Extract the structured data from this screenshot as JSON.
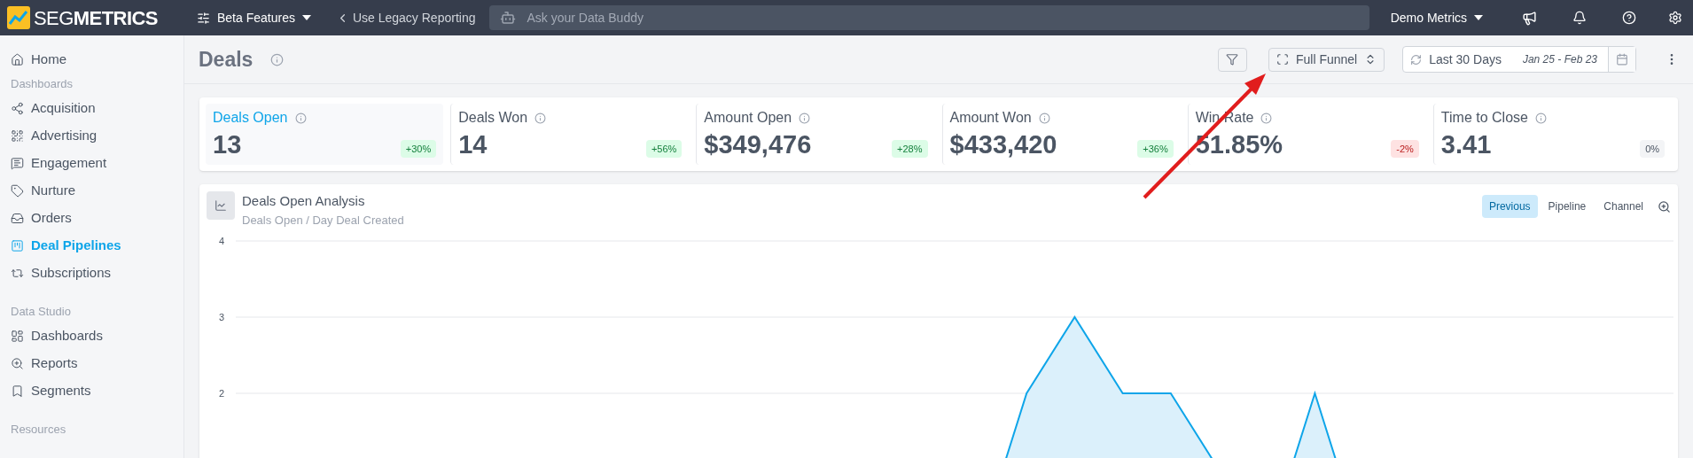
{
  "topbar": {
    "logo": "SEG**METRICS**",
    "beta_menu": "Beta Features",
    "legacy_link": "Use Legacy Reporting",
    "search": {
      "placeholder": "Ask your Data Buddy"
    },
    "account_menu": "Demo Metrics"
  },
  "sidebar": {
    "home": {
      "label": "Home",
      "selected": false
    },
    "sections": [
      {
        "heading": "Dashboards",
        "items": [
          {
            "label": "Acquisition",
            "selected": false
          },
          {
            "label": "Advertising",
            "selected": false
          },
          {
            "label": "Engagement",
            "selected": false
          },
          {
            "label": "Nurture",
            "selected": false
          },
          {
            "label": "Orders",
            "selected": false
          },
          {
            "label": "Deal Pipelines",
            "selected": true
          },
          {
            "label": "Subscriptions",
            "selected": false
          }
        ]
      },
      {
        "heading": "Data Studio",
        "items": [
          {
            "label": "Dashboards",
            "selected": false
          },
          {
            "label": "Reports",
            "selected": false
          },
          {
            "label": "Segments",
            "selected": false
          }
        ]
      },
      {
        "heading": "Resources"
      }
    ]
  },
  "header": {
    "title": "Deals",
    "funnel_select": "Full Funnel",
    "date_range": {
      "label": "Last 30 Days",
      "dates": "Jan 25 - Feb 23"
    }
  },
  "metrics": [
    {
      "label": "Deals Open",
      "value": "13",
      "change": "+30%",
      "kind": "up",
      "selected": true
    },
    {
      "label": "Deals Won",
      "value": "14",
      "change": "+56%",
      "kind": "up",
      "selected": false
    },
    {
      "label": "Amount Open",
      "value": "$349,476",
      "change": "+28%",
      "kind": "up",
      "selected": false
    },
    {
      "label": "Amount Won",
      "value": "$433,420",
      "change": "+36%",
      "kind": "up",
      "selected": false
    },
    {
      "label": "Win Rate",
      "value": "51.85%",
      "change": "-2%",
      "kind": "down",
      "selected": false
    },
    {
      "label": "Time to Close",
      "value": "3.41",
      "change": "0%",
      "kind": "flat",
      "selected": false
    }
  ],
  "analysis": {
    "title": "Deals Open Analysis",
    "subtitle": "Deals Open / Day Deal Created",
    "toggles": [
      {
        "label": "Previous",
        "selected": true
      },
      {
        "label": "Pipeline",
        "selected": false
      },
      {
        "label": "Channel",
        "selected": false
      }
    ],
    "chart_data": {
      "type": "area",
      "ylim": [
        0,
        4
      ],
      "yticks": [
        2,
        3,
        4
      ],
      "series": [
        {
          "color": "#0ea5e9",
          "values": [
            0,
            0,
            0,
            0,
            0,
            0,
            0,
            0,
            0,
            0,
            0,
            0,
            0,
            0,
            0,
            0,
            2,
            3,
            2,
            2,
            1,
            0,
            2,
            0,
            0,
            0,
            0,
            0,
            0,
            0
          ]
        }
      ]
    }
  }
}
